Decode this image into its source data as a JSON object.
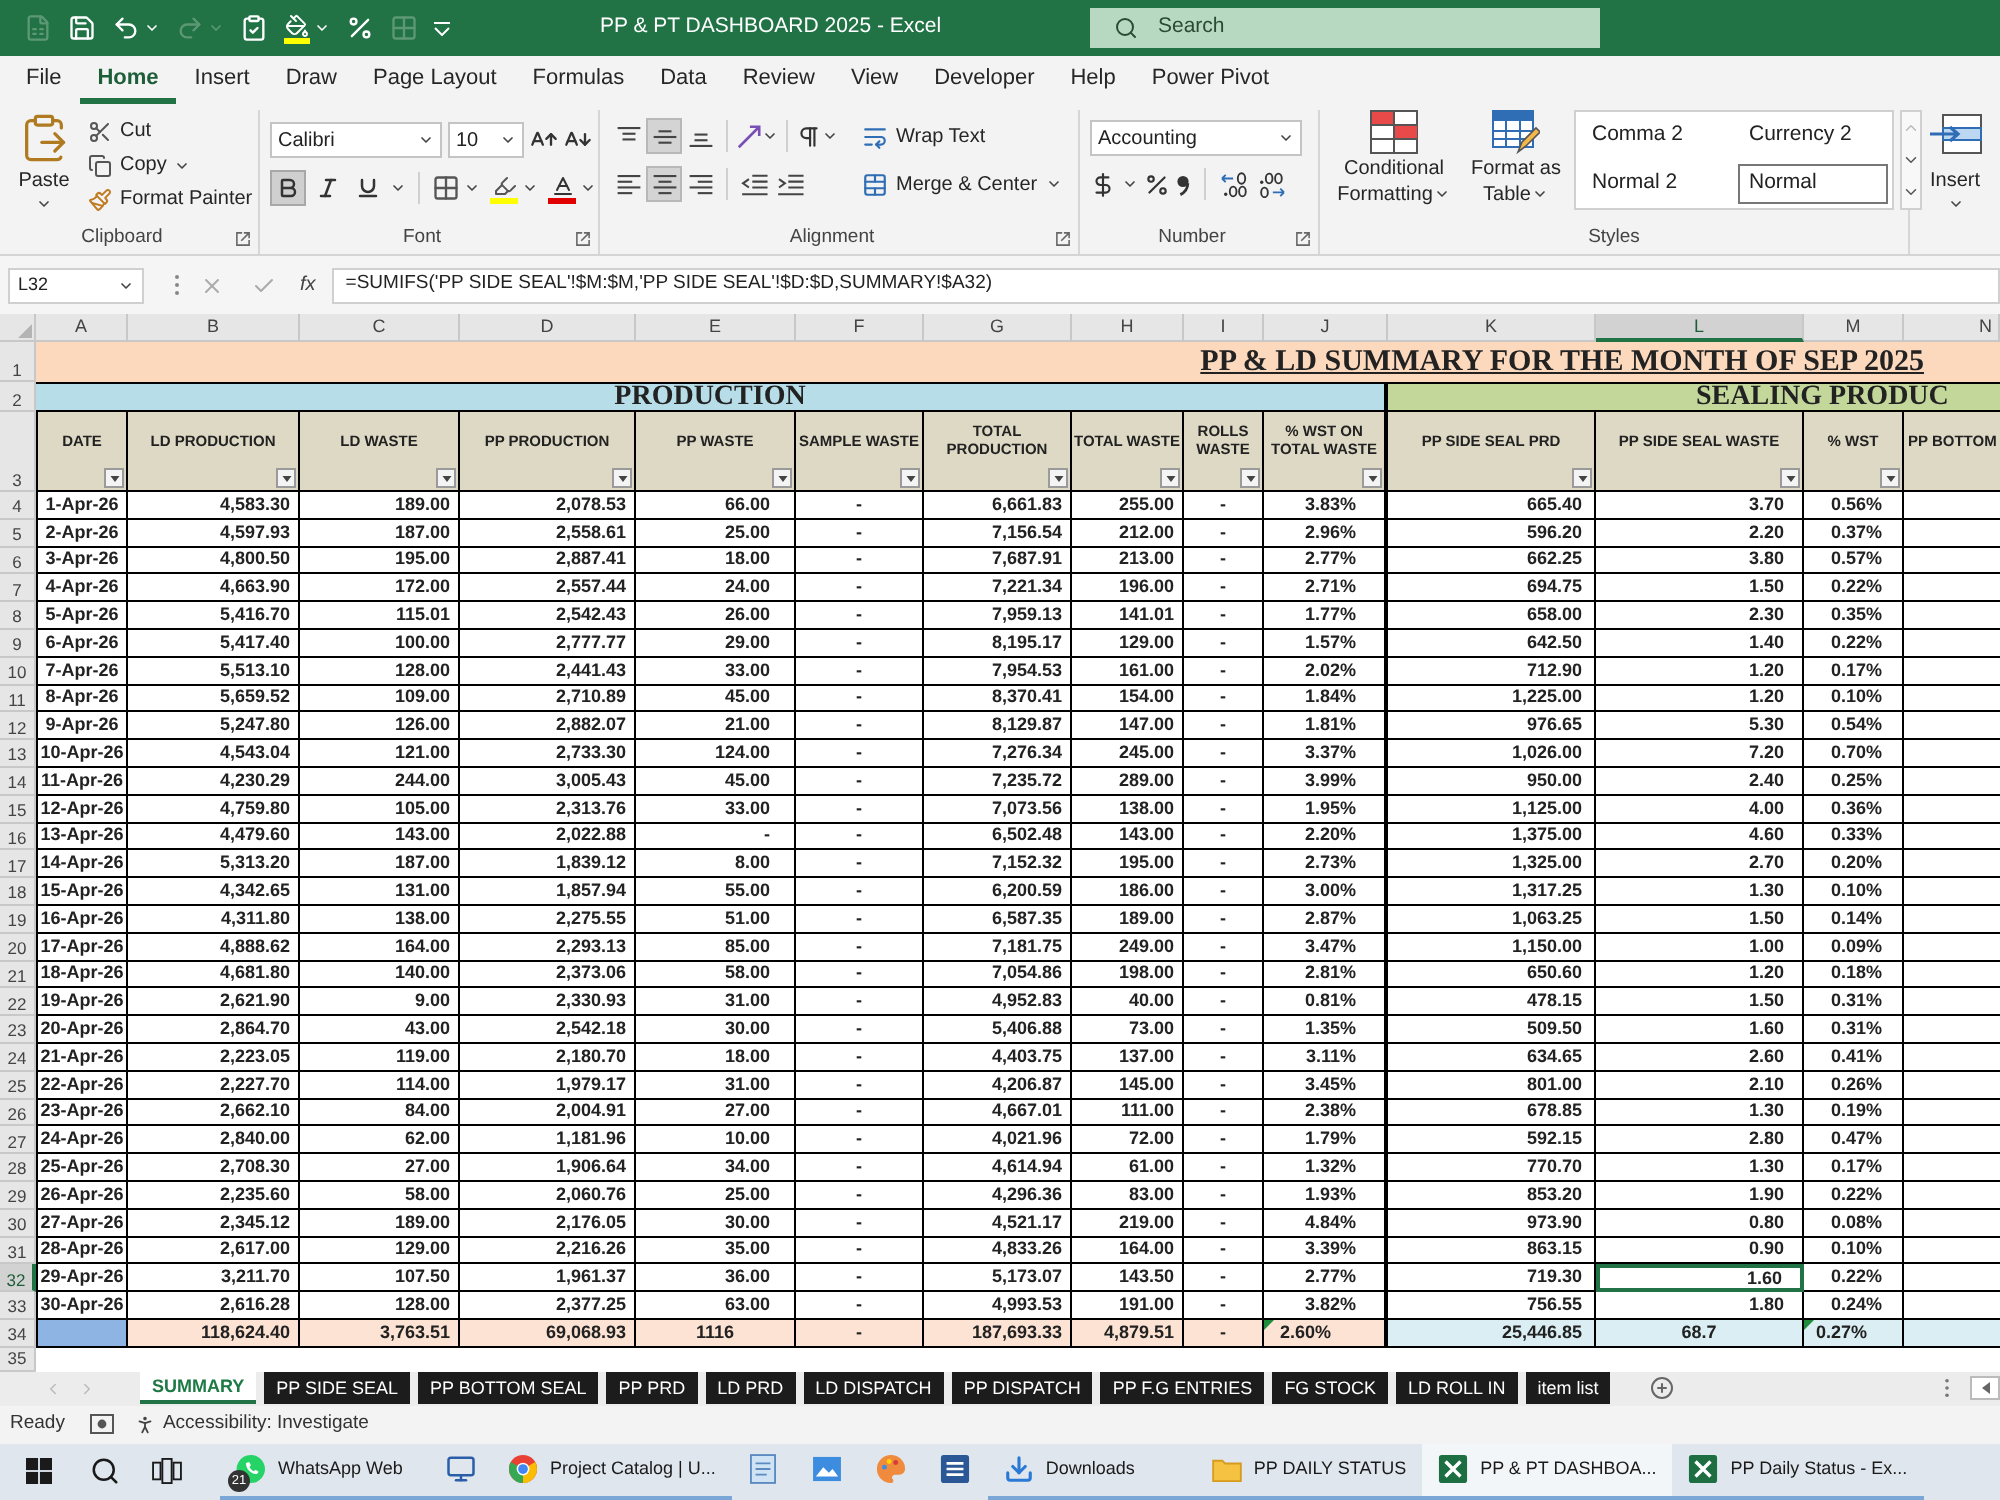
{
  "title_bar": {
    "title": "PP & PT DASHBOARD 2025 - Excel",
    "search": {
      "placeholder": "Search"
    }
  },
  "ribbon_tabs": [
    {
      "label": "File",
      "selected": false
    },
    {
      "label": "Home",
      "selected": true
    },
    {
      "label": "Insert",
      "selected": false
    },
    {
      "label": "Draw",
      "selected": false
    },
    {
      "label": "Page Layout",
      "selected": false
    },
    {
      "label": "Formulas",
      "selected": false
    },
    {
      "label": "Data",
      "selected": false
    },
    {
      "label": "Review",
      "selected": false
    },
    {
      "label": "View",
      "selected": false
    },
    {
      "label": "Developer",
      "selected": false
    },
    {
      "label": "Help",
      "selected": false
    },
    {
      "label": "Power Pivot",
      "selected": false
    }
  ],
  "ribbon": {
    "clipboard": {
      "label": "Clipboard",
      "paste": "Paste",
      "cut": "Cut",
      "copy": "Copy",
      "format_painter": "Format Painter"
    },
    "font": {
      "label": "Font",
      "name": "Calibri",
      "size": "10",
      "styles": [
        {
          "kind": "bold",
          "selected": true
        },
        {
          "kind": "italic",
          "selected": false
        },
        {
          "kind": "underline",
          "selected": false
        }
      ]
    },
    "alignment": {
      "label": "Alignment",
      "vertical": [
        {
          "kind": "top",
          "selected": false
        },
        {
          "kind": "middle",
          "selected": true
        },
        {
          "kind": "bottom",
          "selected": false
        }
      ],
      "horizontal": [
        {
          "kind": "left",
          "selected": false
        },
        {
          "kind": "center",
          "selected": true
        },
        {
          "kind": "right",
          "selected": false
        }
      ],
      "wrap_text": "Wrap Text",
      "merge": "Merge & Center"
    },
    "number": {
      "label": "Number",
      "format": "Accounting"
    },
    "styles": {
      "label": "Styles",
      "conditional": "Conditional Formatting",
      "format_table": "Format as Table",
      "gallery": [
        {
          "label": "Comma 2",
          "selected": false
        },
        {
          "label": "Currency 2",
          "selected": false
        },
        {
          "label": "Normal 2",
          "selected": false
        },
        {
          "label": "Normal",
          "selected": true
        }
      ]
    },
    "cells": {
      "insert": "Insert"
    }
  },
  "formula_bar": {
    "name_box": "L32",
    "fx": "fx",
    "formula": "=SUMIFS('PP SIDE SEAL'!$M:$M,'PP SIDE SEAL'!$D:$D,SUMMARY!$A32)"
  },
  "sheet": {
    "columns": [
      {
        "letter": "A",
        "selected": false
      },
      {
        "letter": "B",
        "selected": false
      },
      {
        "letter": "C",
        "selected": false
      },
      {
        "letter": "D",
        "selected": false
      },
      {
        "letter": "E",
        "selected": false
      },
      {
        "letter": "F",
        "selected": false
      },
      {
        "letter": "G",
        "selected": false
      },
      {
        "letter": "H",
        "selected": false
      },
      {
        "letter": "I",
        "selected": false
      },
      {
        "letter": "J",
        "selected": false
      },
      {
        "letter": "K",
        "selected": false
      },
      {
        "letter": "L",
        "selected": true
      },
      {
        "letter": "M",
        "selected": false
      },
      {
        "letter": "N",
        "selected": false
      }
    ],
    "title_row": {
      "num": "1",
      "selected": false,
      "text": "PP & LD SUMMARY FOR THE MONTH OF SEP 2025"
    },
    "section_row": {
      "num": "2",
      "selected": false,
      "sections": [
        {
          "text": "PRODUCTION",
          "color": "#b7dee8"
        },
        {
          "text": "SEALING PRODUC",
          "color": "#c4d79b"
        }
      ]
    },
    "header_row": {
      "num": "3",
      "selected": false,
      "titles": [
        {
          "text": "DATE",
          "filter": true
        },
        {
          "text": "LD PRODUCTION",
          "filter": true
        },
        {
          "text": "LD WASTE",
          "filter": true
        },
        {
          "text": "PP PRODUCTION",
          "filter": true
        },
        {
          "text": "PP WASTE",
          "filter": true
        },
        {
          "text": "SAMPLE WASTE",
          "filter": true
        },
        {
          "text": "TOTAL PRODUCTION",
          "filter": true
        },
        {
          "text": "TOTAL WASTE",
          "filter": true
        },
        {
          "text": "ROLLS WASTE",
          "filter": true
        },
        {
          "text": "% WST ON TOTAL WASTE",
          "filter": true
        },
        {
          "text": "PP SIDE SEAL PRD",
          "filter": true
        },
        {
          "text": "PP SIDE SEAL WASTE",
          "filter": true
        },
        {
          "text": "% WST",
          "filter": true
        },
        {
          "text": "PP BOTTOM",
          "filter": false
        }
      ]
    },
    "rows": [
      {
        "num": "4",
        "selected": false,
        "cells": [
          "1-Apr-26",
          "4,583.30",
          "189.00",
          "2,078.53",
          "66.00",
          "-",
          "6,661.83",
          "255.00",
          "-",
          "3.83%",
          "665.40",
          "3.70",
          "0.56%"
        ]
      },
      {
        "num": "5",
        "selected": false,
        "cells": [
          "2-Apr-26",
          "4,597.93",
          "187.00",
          "2,558.61",
          "25.00",
          "-",
          "7,156.54",
          "212.00",
          "-",
          "2.96%",
          "596.20",
          "2.20",
          "0.37%"
        ]
      },
      {
        "num": "6",
        "selected": false,
        "cells": [
          "3-Apr-26",
          "4,800.50",
          "195.00",
          "2,887.41",
          "18.00",
          "-",
          "7,687.91",
          "213.00",
          "-",
          "2.77%",
          "662.25",
          "3.80",
          "0.57%"
        ]
      },
      {
        "num": "7",
        "selected": false,
        "cells": [
          "4-Apr-26",
          "4,663.90",
          "172.00",
          "2,557.44",
          "24.00",
          "-",
          "7,221.34",
          "196.00",
          "-",
          "2.71%",
          "694.75",
          "1.50",
          "0.22%"
        ]
      },
      {
        "num": "8",
        "selected": false,
        "cells": [
          "5-Apr-26",
          "5,416.70",
          "115.01",
          "2,542.43",
          "26.00",
          "-",
          "7,959.13",
          "141.01",
          "-",
          "1.77%",
          "658.00",
          "2.30",
          "0.35%"
        ]
      },
      {
        "num": "9",
        "selected": false,
        "cells": [
          "6-Apr-26",
          "5,417.40",
          "100.00",
          "2,777.77",
          "29.00",
          "-",
          "8,195.17",
          "129.00",
          "-",
          "1.57%",
          "642.50",
          "1.40",
          "0.22%"
        ]
      },
      {
        "num": "10",
        "selected": false,
        "cells": [
          "7-Apr-26",
          "5,513.10",
          "128.00",
          "2,441.43",
          "33.00",
          "-",
          "7,954.53",
          "161.00",
          "-",
          "2.02%",
          "712.90",
          "1.20",
          "0.17%"
        ]
      },
      {
        "num": "11",
        "selected": false,
        "cells": [
          "8-Apr-26",
          "5,659.52",
          "109.00",
          "2,710.89",
          "45.00",
          "-",
          "8,370.41",
          "154.00",
          "-",
          "1.84%",
          "1,225.00",
          "1.20",
          "0.10%"
        ]
      },
      {
        "num": "12",
        "selected": false,
        "cells": [
          "9-Apr-26",
          "5,247.80",
          "126.00",
          "2,882.07",
          "21.00",
          "-",
          "8,129.87",
          "147.00",
          "-",
          "1.81%",
          "976.65",
          "5.30",
          "0.54%"
        ]
      },
      {
        "num": "13",
        "selected": false,
        "cells": [
          "10-Apr-26",
          "4,543.04",
          "121.00",
          "2,733.30",
          "124.00",
          "-",
          "7,276.34",
          "245.00",
          "-",
          "3.37%",
          "1,026.00",
          "7.20",
          "0.70%"
        ]
      },
      {
        "num": "14",
        "selected": false,
        "cells": [
          "11-Apr-26",
          "4,230.29",
          "244.00",
          "3,005.43",
          "45.00",
          "-",
          "7,235.72",
          "289.00",
          "-",
          "3.99%",
          "950.00",
          "2.40",
          "0.25%"
        ]
      },
      {
        "num": "15",
        "selected": false,
        "cells": [
          "12-Apr-26",
          "4,759.80",
          "105.00",
          "2,313.76",
          "33.00",
          "-",
          "7,073.56",
          "138.00",
          "-",
          "1.95%",
          "1,125.00",
          "4.00",
          "0.36%"
        ]
      },
      {
        "num": "16",
        "selected": false,
        "cells": [
          "13-Apr-26",
          "4,479.60",
          "143.00",
          "2,022.88",
          "-",
          "-",
          "6,502.48",
          "143.00",
          "-",
          "2.20%",
          "1,375.00",
          "4.60",
          "0.33%"
        ]
      },
      {
        "num": "17",
        "selected": false,
        "cells": [
          "14-Apr-26",
          "5,313.20",
          "187.00",
          "1,839.12",
          "8.00",
          "-",
          "7,152.32",
          "195.00",
          "-",
          "2.73%",
          "1,325.00",
          "2.70",
          "0.20%"
        ]
      },
      {
        "num": "18",
        "selected": false,
        "cells": [
          "15-Apr-26",
          "4,342.65",
          "131.00",
          "1,857.94",
          "55.00",
          "-",
          "6,200.59",
          "186.00",
          "-",
          "3.00%",
          "1,317.25",
          "1.30",
          "0.10%"
        ]
      },
      {
        "num": "19",
        "selected": false,
        "cells": [
          "16-Apr-26",
          "4,311.80",
          "138.00",
          "2,275.55",
          "51.00",
          "-",
          "6,587.35",
          "189.00",
          "-",
          "2.87%",
          "1,063.25",
          "1.50",
          "0.14%"
        ]
      },
      {
        "num": "20",
        "selected": false,
        "cells": [
          "17-Apr-26",
          "4,888.62",
          "164.00",
          "2,293.13",
          "85.00",
          "-",
          "7,181.75",
          "249.00",
          "-",
          "3.47%",
          "1,150.00",
          "1.00",
          "0.09%"
        ]
      },
      {
        "num": "21",
        "selected": false,
        "cells": [
          "18-Apr-26",
          "4,681.80",
          "140.00",
          "2,373.06",
          "58.00",
          "-",
          "7,054.86",
          "198.00",
          "-",
          "2.81%",
          "650.60",
          "1.20",
          "0.18%"
        ]
      },
      {
        "num": "22",
        "selected": false,
        "cells": [
          "19-Apr-26",
          "2,621.90",
          "9.00",
          "2,330.93",
          "31.00",
          "-",
          "4,952.83",
          "40.00",
          "-",
          "0.81%",
          "478.15",
          "1.50",
          "0.31%"
        ]
      },
      {
        "num": "23",
        "selected": false,
        "cells": [
          "20-Apr-26",
          "2,864.70",
          "43.00",
          "2,542.18",
          "30.00",
          "-",
          "5,406.88",
          "73.00",
          "-",
          "1.35%",
          "509.50",
          "1.60",
          "0.31%"
        ]
      },
      {
        "num": "24",
        "selected": false,
        "cells": [
          "21-Apr-26",
          "2,223.05",
          "119.00",
          "2,180.70",
          "18.00",
          "-",
          "4,403.75",
          "137.00",
          "-",
          "3.11%",
          "634.65",
          "2.60",
          "0.41%"
        ]
      },
      {
        "num": "25",
        "selected": false,
        "cells": [
          "22-Apr-26",
          "2,227.70",
          "114.00",
          "1,979.17",
          "31.00",
          "-",
          "4,206.87",
          "145.00",
          "-",
          "3.45%",
          "801.00",
          "2.10",
          "0.26%"
        ]
      },
      {
        "num": "26",
        "selected": false,
        "cells": [
          "23-Apr-26",
          "2,662.10",
          "84.00",
          "2,004.91",
          "27.00",
          "-",
          "4,667.01",
          "111.00",
          "-",
          "2.38%",
          "678.85",
          "1.30",
          "0.19%"
        ]
      },
      {
        "num": "27",
        "selected": false,
        "cells": [
          "24-Apr-26",
          "2,840.00",
          "62.00",
          "1,181.96",
          "10.00",
          "-",
          "4,021.96",
          "72.00",
          "-",
          "1.79%",
          "592.15",
          "2.80",
          "0.47%"
        ]
      },
      {
        "num": "28",
        "selected": false,
        "cells": [
          "25-Apr-26",
          "2,708.30",
          "27.00",
          "1,906.64",
          "34.00",
          "-",
          "4,614.94",
          "61.00",
          "-",
          "1.32%",
          "770.70",
          "1.30",
          "0.17%"
        ]
      },
      {
        "num": "29",
        "selected": false,
        "cells": [
          "26-Apr-26",
          "2,235.60",
          "58.00",
          "2,060.76",
          "25.00",
          "-",
          "4,296.36",
          "83.00",
          "-",
          "1.93%",
          "853.20",
          "1.90",
          "0.22%"
        ]
      },
      {
        "num": "30",
        "selected": false,
        "cells": [
          "27-Apr-26",
          "2,345.12",
          "189.00",
          "2,176.05",
          "30.00",
          "-",
          "4,521.17",
          "219.00",
          "-",
          "4.84%",
          "973.90",
          "0.80",
          "0.08%"
        ]
      },
      {
        "num": "31",
        "selected": false,
        "cells": [
          "28-Apr-26",
          "2,617.00",
          "129.00",
          "2,216.26",
          "35.00",
          "-",
          "4,833.26",
          "164.00",
          "-",
          "3.39%",
          "863.15",
          "0.90",
          "0.10%"
        ]
      },
      {
        "num": "32",
        "selected": true,
        "cells": [
          "29-Apr-26",
          "3,211.70",
          "107.50",
          "1,961.37",
          "36.00",
          "-",
          "5,173.07",
          "143.50",
          "-",
          "2.77%",
          "719.30",
          "1.60",
          "0.22%"
        ]
      },
      {
        "num": "33",
        "selected": false,
        "cells": [
          "30-Apr-26",
          "2,616.28",
          "128.00",
          "2,377.25",
          "63.00",
          "-",
          "4,993.53",
          "191.00",
          "-",
          "3.82%",
          "756.55",
          "1.80",
          "0.24%"
        ]
      }
    ],
    "total_row": {
      "num": "34",
      "selected": false,
      "cells": [
        {
          "text": "118,624.40",
          "flagged": false
        },
        {
          "text": "3,763.51",
          "flagged": false
        },
        {
          "text": "69,068.93",
          "flagged": false
        },
        {
          "text": "1116",
          "flagged": false
        },
        {
          "text": "-",
          "flagged": false
        },
        {
          "text": "187,693.33",
          "flagged": false
        },
        {
          "text": "4,879.51",
          "flagged": false
        },
        {
          "text": "-",
          "flagged": false
        },
        {
          "text": "2.60%",
          "flagged": true
        },
        {
          "text": "25,446.85",
          "flagged": false
        },
        {
          "text": "68.7",
          "flagged": false
        },
        {
          "text": "0.27%",
          "flagged": true
        }
      ]
    },
    "blank_row": {
      "num": "35",
      "selected": false
    }
  },
  "sheet_tabs": [
    {
      "label": "SUMMARY",
      "selected": true
    },
    {
      "label": "PP SIDE SEAL",
      "selected": false
    },
    {
      "label": "PP BOTTOM SEAL",
      "selected": false
    },
    {
      "label": "PP PRD",
      "selected": false
    },
    {
      "label": "LD PRD",
      "selected": false
    },
    {
      "label": "LD DISPATCH",
      "selected": false
    },
    {
      "label": "PP DISPATCH",
      "selected": false
    },
    {
      "label": "PP F.G ENTRIES",
      "selected": false
    },
    {
      "label": "FG STOCK",
      "selected": false
    },
    {
      "label": "LD ROLL IN",
      "selected": false
    },
    {
      "label": "item list",
      "selected": false
    }
  ],
  "status_bar": {
    "status": "Ready",
    "accessibility": "Accessibility: Investigate"
  },
  "taskbar": {
    "items": [
      {
        "kind": "chat",
        "label": "WhatsApp Web",
        "badge": "21",
        "running": true,
        "selected": false
      },
      {
        "kind": "monitor",
        "running": true,
        "selected": false
      },
      {
        "kind": "browser",
        "label": "Project Catalog | U...",
        "running": true,
        "selected": false
      },
      {
        "kind": "notepad",
        "running": false,
        "selected": false
      },
      {
        "kind": "picture",
        "running": false,
        "selected": false
      },
      {
        "kind": "paint",
        "running": false,
        "selected": false
      },
      {
        "kind": "document",
        "running": false,
        "selected": false
      },
      {
        "kind": "download",
        "label": "Downloads",
        "running": true,
        "selected": false
      },
      {
        "kind": "folder",
        "label": "PP DAILY STATUS",
        "running": true,
        "selected": false
      },
      {
        "kind": "spreadsheet",
        "label": "PP & PT DASHBOA...",
        "running": true,
        "selected": true
      },
      {
        "kind": "spreadsheet",
        "label": "PP Daily Status - Ex...",
        "running": true,
        "selected": false
      }
    ]
  }
}
